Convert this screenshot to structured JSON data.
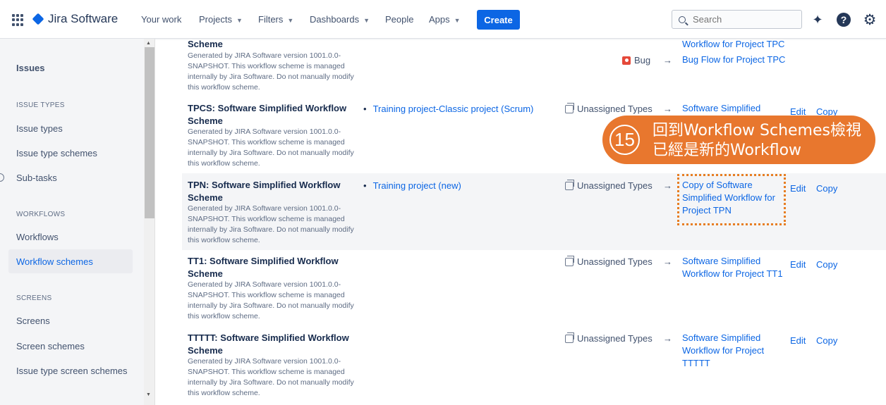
{
  "nav": {
    "product": "Jira Software",
    "items": [
      "Your work",
      "Projects",
      "Filters",
      "Dashboards",
      "People",
      "Apps"
    ],
    "create": "Create",
    "search_placeholder": "Search"
  },
  "sidebar": {
    "title": "Issues",
    "sections": [
      {
        "heading": "ISSUE TYPES",
        "items": [
          "Issue types",
          "Issue type schemes",
          "Sub-tasks"
        ]
      },
      {
        "heading": "WORKFLOWS",
        "items": [
          "Workflows",
          "Workflow schemes"
        ]
      },
      {
        "heading": "SCREENS",
        "items": [
          "Screens",
          "Screen schemes",
          "Issue type screen schemes"
        ]
      }
    ],
    "active": "Workflow schemes"
  },
  "description": "Generated by JIRA Software version 1001.0.0-SNAPSHOT. This workflow scheme is managed internally by Jira Software. Do not manually modify this workflow scheme.",
  "rows": [
    {
      "name": "Scheme",
      "project": "",
      "mappings": [
        {
          "type": "",
          "workflow": "Workflow for Project TPC"
        },
        {
          "type": "Bug",
          "workflow": "Bug Flow for Project TPC"
        }
      ]
    },
    {
      "name": "TPCS: Software Simplified Workflow Scheme",
      "project": "Training project-Classic project (Scrum)",
      "type": "Unassigned Types",
      "workflow": "Software Simplified"
    },
    {
      "name": "TPN: Software Simplified Workflow Scheme",
      "project": "Training project (new)",
      "type": "Unassigned Types",
      "workflow": "Copy of Software Simplified Workflow for Project TPN"
    },
    {
      "name": "TT1: Software Simplified Workflow Scheme",
      "project": "",
      "type": "Unassigned Types",
      "workflow": "Software Simplified Workflow for Project TT1"
    },
    {
      "name": "TTTTT: Software Simplified Workflow Scheme",
      "project": "",
      "type": "Unassigned Types",
      "workflow": "Software Simplified Workflow for Project TTTTT"
    }
  ],
  "actions": {
    "edit": "Edit",
    "copy": "Copy"
  },
  "arrow": "→",
  "callout": {
    "number": "15",
    "line1": "回到Workflow Schemes檢視",
    "line2": "已經是新的Workflow"
  }
}
